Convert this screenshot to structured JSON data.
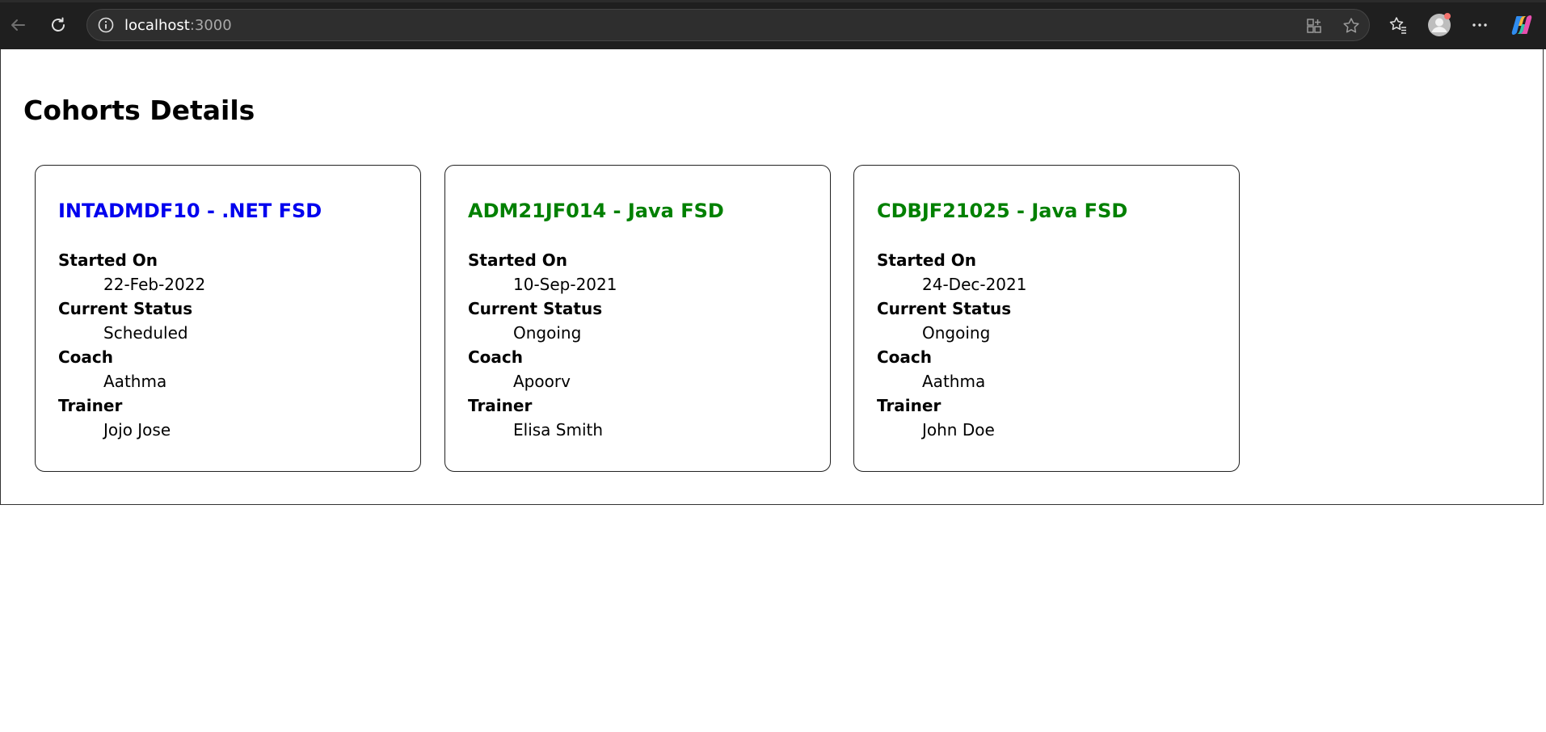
{
  "browser": {
    "url_host": "localhost",
    "url_port": ":3000"
  },
  "page": {
    "heading": "Cohorts Details"
  },
  "cohorts": [
    {
      "title": "INTADMDF10 - .NET FSD",
      "title_color": "#0000ee",
      "started_on_label": "Started On",
      "started_on": "22-Feb-2022",
      "status_label": "Current Status",
      "status": "Scheduled",
      "coach_label": "Coach",
      "coach": "Aathma",
      "trainer_label": "Trainer",
      "trainer": "Jojo Jose"
    },
    {
      "title": "ADM21JF014 - Java FSD",
      "title_color": "#008000",
      "started_on_label": "Started On",
      "started_on": "10-Sep-2021",
      "status_label": "Current Status",
      "status": "Ongoing",
      "coach_label": "Coach",
      "coach": "Apoorv",
      "trainer_label": "Trainer",
      "trainer": "Elisa Smith"
    },
    {
      "title": "CDBJF21025 - Java FSD",
      "title_color": "#008000",
      "started_on_label": "Started On",
      "started_on": "24-Dec-2021",
      "status_label": "Current Status",
      "status": "Ongoing",
      "coach_label": "Coach",
      "coach": "Aathma",
      "trainer_label": "Trainer",
      "trainer": "John Doe"
    }
  ]
}
